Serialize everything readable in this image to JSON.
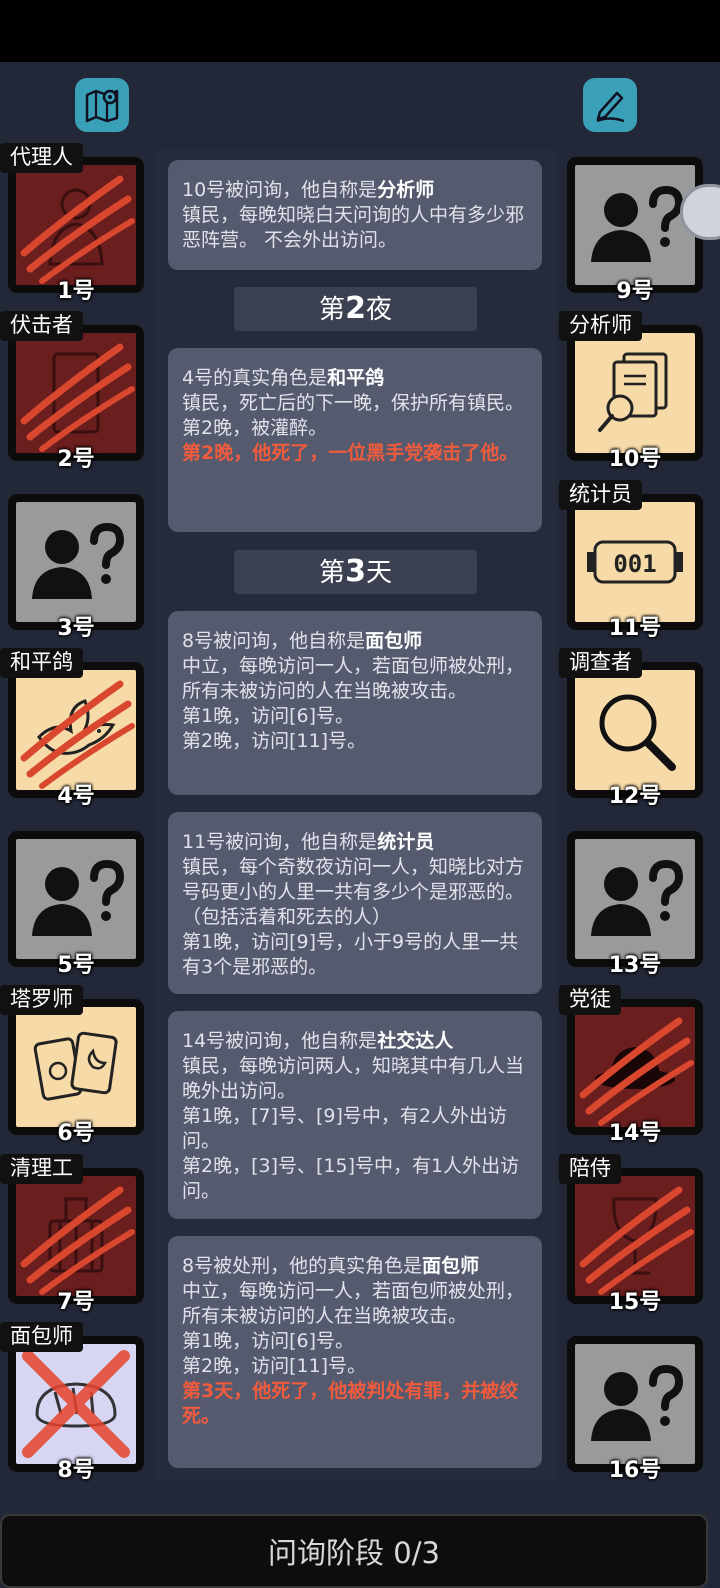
{
  "players_left": [
    {
      "tag": "代理人",
      "num": "1号",
      "state": "dead",
      "icon": "agent-figure-icon"
    },
    {
      "tag": "伏击者",
      "num": "2号",
      "state": "dead",
      "icon": "ambusher-figure-icon"
    },
    {
      "tag": "",
      "num": "3号",
      "state": "unknown",
      "icon": "unknown-person-icon"
    },
    {
      "tag": "和平鸽",
      "num": "4号",
      "state": "known-dead",
      "icon": "dove-icon"
    },
    {
      "tag": "",
      "num": "5号",
      "state": "unknown",
      "icon": "unknown-person-icon"
    },
    {
      "tag": "塔罗师",
      "num": "6号",
      "state": "known",
      "icon": "tarot-cards-icon"
    },
    {
      "tag": "清理工",
      "num": "7号",
      "state": "dead",
      "icon": "cleaner-icon"
    },
    {
      "tag": "面包师",
      "num": "8号",
      "state": "executed",
      "icon": "bread-icon"
    }
  ],
  "players_right": [
    {
      "tag": "",
      "num": "9号",
      "state": "unknown",
      "icon": "unknown-person-icon"
    },
    {
      "tag": "分析师",
      "num": "10号",
      "state": "known",
      "icon": "documents-magnifier-icon"
    },
    {
      "tag": "统计员",
      "num": "11号",
      "state": "known",
      "icon": "counter-icon"
    },
    {
      "tag": "调查者",
      "num": "12号",
      "state": "known",
      "icon": "magnifier-icon"
    },
    {
      "tag": "",
      "num": "13号",
      "state": "unknown",
      "icon": "unknown-person-icon"
    },
    {
      "tag": "党徒",
      "num": "14号",
      "state": "dead",
      "icon": "hat-icon"
    },
    {
      "tag": "陪侍",
      "num": "15号",
      "state": "dead",
      "icon": "wine-glass-icon"
    },
    {
      "tag": "",
      "num": "16号",
      "state": "unknown",
      "icon": "unknown-person-icon"
    }
  ],
  "log": {
    "m1": {
      "lead": "10号被问询，他自称是",
      "role": "分析师",
      "text": "镇民，每晚知晓白天问询的人中有多少邪恶阵营。 不会外出访问。"
    },
    "d1": {
      "pre": "第",
      "n": "2",
      "post": "夜"
    },
    "m2": {
      "lead": "4号的真实角色是",
      "role": "和平鸽",
      "text": "镇民，死亡后的下一晚，保护所有镇民。",
      "l1": "第2晚，被灌醉。",
      "red": "第2晚，他死了，一位黑手党袭击了他。"
    },
    "d2": {
      "pre": "第",
      "n": "3",
      "post": "天"
    },
    "m3": {
      "lead": "8号被问询，他自称是",
      "role": "面包师",
      "text": "中立，每晚访问一人，若面包师被处刑，所有未被访问的人在当晚被攻击。",
      "l1": "第1晚，访问[6]号。",
      "l2": "第2晚，访问[11]号。"
    },
    "m4": {
      "lead": "11号被问询，他自称是",
      "role": "统计员",
      "text": "镇民，每个奇数夜访问一人，知晓比对方号码更小的人里一共有多少个是邪恶的。（包括活着和死去的人）",
      "l1": "第1晚，访问[9]号，小于9号的人里一共有3个是邪恶的。"
    },
    "m5": {
      "lead": "14号被问询，他自称是",
      "role": "社交达人",
      "text": "镇民，每晚访问两人，知晓其中有几人当晚外出访问。",
      "l1": "第1晚，[7]号、[9]号中，有2人外出访问。",
      "l2": "第2晚，[3]号、[15]号中，有1人外出访问。"
    },
    "m6": {
      "lead": "8号被处刑，他的真实角色是",
      "role": "面包师",
      "text": "中立，每晚访问一人，若面包师被处刑，所有未被访问的人在当晚被攻击。",
      "l1": "第1晚，访问[6]号。",
      "l2": "第2晚，访问[11]号。",
      "red": "第3天，他死了，他被判处有罪，并被绞死。"
    }
  },
  "bottom": {
    "label": "问询阶段 0/3"
  },
  "colors": {
    "accent": "#3aa0b8",
    "dead": "#6a1e1e",
    "known": "#f6dba9",
    "red_text": "#f05b3d",
    "claw": "#d9472e"
  }
}
